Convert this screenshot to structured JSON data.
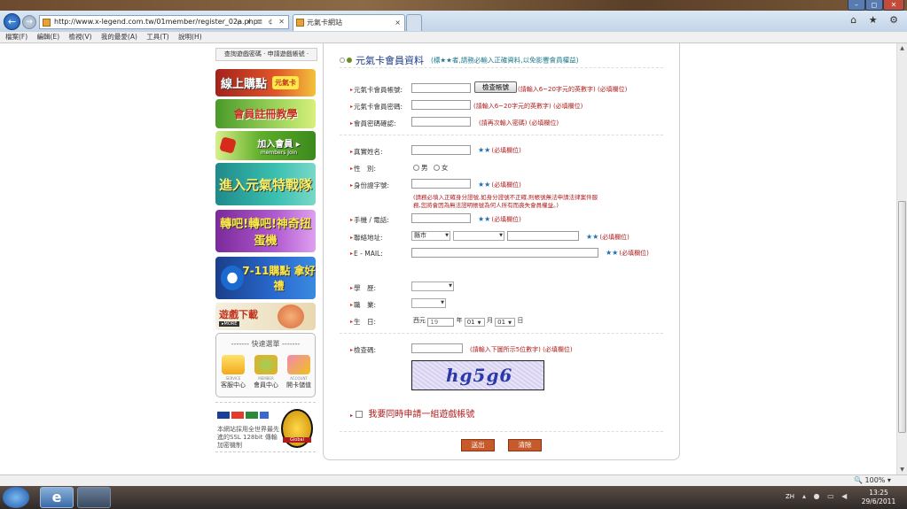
{
  "browser": {
    "address": "http://www.x-legend.com.tw/01member/register_02a.php",
    "address_tools": "ρ ▾ ≣ ¢ ✕",
    "tab_title": "元氣卡網站",
    "tab_close": "×",
    "nav_back": "←",
    "nav_forward": "→",
    "window_controls": [
      "–",
      "◻",
      "✕"
    ],
    "tools_right": "⌂ ★ ⚙"
  },
  "menu": [
    "檔案(F)",
    "編輯(E)",
    "檢視(V)",
    "我的最愛(A)",
    "工具(T)",
    "說明(H)"
  ],
  "sidebar": {
    "top_links": "查詢遊戲密碼 · 申請遊戲帳號 ·",
    "banners": [
      {
        "text": "線上購點",
        "extra": "元氣卡"
      },
      {
        "text": "會員註冊教學"
      },
      {
        "text": "加入會員 ▸",
        "sub": "members Join"
      },
      {
        "text": "進入元氣特戰隊"
      },
      {
        "text": "轉吧!轉吧!神奇扭蛋機"
      },
      {
        "text": "7-11購點 拿好禮"
      },
      {
        "text": "遊戲下載",
        "sub": "▸MORE"
      }
    ],
    "quick": {
      "title": "------- 快速選單 -------",
      "items": [
        {
          "en": "SERVICE",
          "label": "客服中心"
        },
        {
          "en": "MEMBER",
          "label": "會員中心"
        },
        {
          "en": "ACCOUNT",
          "label": "開卡儲值"
        }
      ]
    },
    "secure_text": "本網站採用全世界最先進的SSL 128bit 傳輸加密機制",
    "seal_text": "Global"
  },
  "form": {
    "title": "元氣卡會員資料",
    "subtitle": "(標★★者,請務必輸入正確資料,以免影響會員權益)",
    "labels": {
      "account": "元氣卡會員帳號:",
      "password": "元氣卡會員密碼:",
      "confirm": "會員密碼確認:",
      "name": "真實姓名:",
      "gender": "性　別:",
      "id": "身份證字號:",
      "phone": "手機 / 電話:",
      "address": "聯絡地址:",
      "email": "E - MAIL:",
      "education": "學　歷:",
      "occupation": "職　業:",
      "birthday": "生　日:",
      "code": "檢查碼:"
    },
    "check_account_button": "檢查帳號",
    "notes": {
      "account": "(請輸入6~20字元的英數字)",
      "password": "(請輸入6~20字元的英數字)",
      "confirm": "(請再次輸入密碼)",
      "id_warning_1": "(請務必填入正確身分證號,如身分證號不正確,則帳號無法申請法律案件服",
      "id_warning_2": "務,您將會因為無法證明帳號為何人所有而喪失會員權益。)",
      "code": "(請輸入下圖所示5位數字)"
    },
    "required_text": "(必填欄位)",
    "stars": "★★",
    "gender_male": "男",
    "gender_female": "女",
    "address_city": "縣市",
    "birthday": {
      "prefix": "西元",
      "year": "19",
      "year_unit": "年",
      "month": "01",
      "month_unit": "月",
      "day": "01",
      "day_unit": "日"
    },
    "captcha_text": "hg5g6",
    "also_apply": "我要同時申請一組遊戲帳號",
    "submit_button": "送出",
    "clear_button": "清除"
  },
  "status": {
    "zoom": "100%"
  },
  "taskbar": {
    "lang": "ZH",
    "time": "13:25",
    "date": "29/6/2011"
  }
}
